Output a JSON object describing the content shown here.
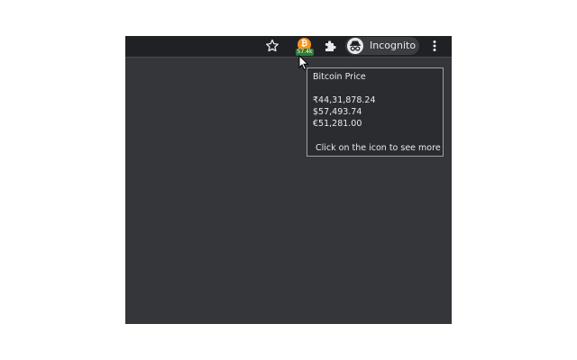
{
  "toolbar": {
    "star_icon": "star-outline-icon",
    "extension": {
      "icon": "bitcoin-icon",
      "coin_glyph": "₿",
      "badge_text": "57.4k",
      "badge_color": "#2e7d32",
      "coin_color": "#f7931a"
    },
    "puzzle_icon": "puzzle-piece-icon",
    "incognito": {
      "icon": "incognito-icon",
      "label": "Incognito"
    },
    "menu_icon": "three-dots-vertical-icon"
  },
  "tooltip": {
    "title": "Bitcoin Price",
    "prices": [
      "₹44,31,878.24",
      "$57,493.74",
      "€51,281.00"
    ],
    "hint": "Click on the icon to see more"
  },
  "colors": {
    "toolbar_bg": "#202124",
    "content_bg": "#35363a",
    "tooltip_bg": "#2b2c30",
    "text": "#e8eaed"
  }
}
